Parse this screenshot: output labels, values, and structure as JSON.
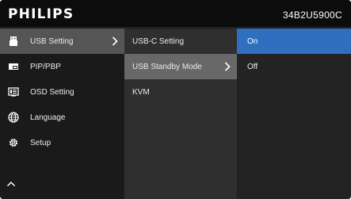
{
  "header": {
    "brand": "PHILIPS",
    "model": "34B2U5900C"
  },
  "main_menu": {
    "items": [
      {
        "label": "USB Setting",
        "icon": "usb-icon"
      },
      {
        "label": "PIP/PBP",
        "icon": "pip-icon"
      },
      {
        "label": "OSD Setting",
        "icon": "osd-icon"
      },
      {
        "label": "Language",
        "icon": "globe-icon"
      },
      {
        "label": "Setup",
        "icon": "gear-icon"
      }
    ],
    "scroll_icon": "chevron-up-icon"
  },
  "submenu": {
    "items": [
      {
        "label": "USB-C Setting"
      },
      {
        "label": "USB Standby Mode"
      },
      {
        "label": "KVM"
      }
    ]
  },
  "options": {
    "items": [
      {
        "label": "On"
      },
      {
        "label": "Off"
      }
    ]
  },
  "colors": {
    "accent": "#2f6fc0",
    "background": "#161616"
  }
}
